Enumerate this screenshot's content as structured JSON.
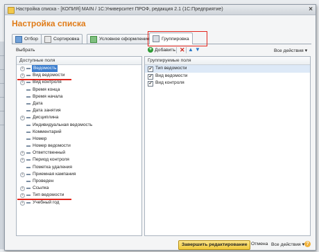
{
  "window": {
    "title": "Настройка списка - [КОПИЯ] MAIN / 1С:Университет ПРОФ, редакция 2.1  (1С:Предприятие)",
    "close_glyph": "×"
  },
  "heading": "Настройка списка",
  "tabs": [
    {
      "label": "Отбор"
    },
    {
      "label": "Сортировка"
    },
    {
      "label": "Условное оформление"
    },
    {
      "label": "Группировка"
    }
  ],
  "left": {
    "choose_label": "Выбрать",
    "header": "Доступные поля",
    "items": [
      {
        "label": "Ведомость"
      },
      {
        "label": "Вид ведомости"
      },
      {
        "label": "Вид контроля"
      },
      {
        "label": "Время конца"
      },
      {
        "label": "Время начала"
      },
      {
        "label": "Дата"
      },
      {
        "label": "Дата занятия"
      },
      {
        "label": "Дисциплина"
      },
      {
        "label": "Индивидуальная ведомость"
      },
      {
        "label": "Комментарий"
      },
      {
        "label": "Номер"
      },
      {
        "label": "Номер ведомости"
      },
      {
        "label": "Ответственный"
      },
      {
        "label": "Период контроля"
      },
      {
        "label": "Пометка удаления"
      },
      {
        "label": "Приемная кампания"
      },
      {
        "label": "Проведен"
      },
      {
        "label": "Ссылка"
      },
      {
        "label": "Тип ведомости"
      },
      {
        "label": "Учебный год"
      }
    ]
  },
  "toolbar": {
    "add_label": "Добавить",
    "all_actions": "Все действия ▾"
  },
  "right": {
    "header": "Группируемые поля",
    "items": [
      {
        "label": "Тип ведомости",
        "checked": true
      },
      {
        "label": "Вид ведомости",
        "checked": true
      },
      {
        "label": "Вид контроля",
        "checked": true
      }
    ]
  },
  "footer": {
    "finish_label": "Завершить редактирование",
    "cancel_label": "Отмена",
    "all_actions": "Все действия ▾",
    "help_glyph": "?"
  },
  "colors": {
    "heading": "#e07b17",
    "highlight_red": "#e3241b",
    "selection": "#3d7fcf"
  }
}
